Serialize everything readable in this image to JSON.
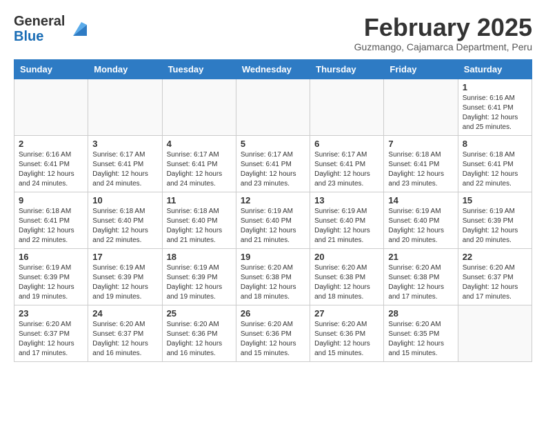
{
  "header": {
    "logo_general": "General",
    "logo_blue": "Blue",
    "month_title": "February 2025",
    "subtitle": "Guzmango, Cajamarca Department, Peru"
  },
  "days_of_week": [
    "Sunday",
    "Monday",
    "Tuesday",
    "Wednesday",
    "Thursday",
    "Friday",
    "Saturday"
  ],
  "weeks": [
    [
      {
        "day": "",
        "info": ""
      },
      {
        "day": "",
        "info": ""
      },
      {
        "day": "",
        "info": ""
      },
      {
        "day": "",
        "info": ""
      },
      {
        "day": "",
        "info": ""
      },
      {
        "day": "",
        "info": ""
      },
      {
        "day": "1",
        "info": "Sunrise: 6:16 AM\nSunset: 6:41 PM\nDaylight: 12 hours and 25 minutes."
      }
    ],
    [
      {
        "day": "2",
        "info": "Sunrise: 6:16 AM\nSunset: 6:41 PM\nDaylight: 12 hours and 24 minutes."
      },
      {
        "day": "3",
        "info": "Sunrise: 6:17 AM\nSunset: 6:41 PM\nDaylight: 12 hours and 24 minutes."
      },
      {
        "day": "4",
        "info": "Sunrise: 6:17 AM\nSunset: 6:41 PM\nDaylight: 12 hours and 24 minutes."
      },
      {
        "day": "5",
        "info": "Sunrise: 6:17 AM\nSunset: 6:41 PM\nDaylight: 12 hours and 23 minutes."
      },
      {
        "day": "6",
        "info": "Sunrise: 6:17 AM\nSunset: 6:41 PM\nDaylight: 12 hours and 23 minutes."
      },
      {
        "day": "7",
        "info": "Sunrise: 6:18 AM\nSunset: 6:41 PM\nDaylight: 12 hours and 23 minutes."
      },
      {
        "day": "8",
        "info": "Sunrise: 6:18 AM\nSunset: 6:41 PM\nDaylight: 12 hours and 22 minutes."
      }
    ],
    [
      {
        "day": "9",
        "info": "Sunrise: 6:18 AM\nSunset: 6:41 PM\nDaylight: 12 hours and 22 minutes."
      },
      {
        "day": "10",
        "info": "Sunrise: 6:18 AM\nSunset: 6:40 PM\nDaylight: 12 hours and 22 minutes."
      },
      {
        "day": "11",
        "info": "Sunrise: 6:18 AM\nSunset: 6:40 PM\nDaylight: 12 hours and 21 minutes."
      },
      {
        "day": "12",
        "info": "Sunrise: 6:19 AM\nSunset: 6:40 PM\nDaylight: 12 hours and 21 minutes."
      },
      {
        "day": "13",
        "info": "Sunrise: 6:19 AM\nSunset: 6:40 PM\nDaylight: 12 hours and 21 minutes."
      },
      {
        "day": "14",
        "info": "Sunrise: 6:19 AM\nSunset: 6:40 PM\nDaylight: 12 hours and 20 minutes."
      },
      {
        "day": "15",
        "info": "Sunrise: 6:19 AM\nSunset: 6:39 PM\nDaylight: 12 hours and 20 minutes."
      }
    ],
    [
      {
        "day": "16",
        "info": "Sunrise: 6:19 AM\nSunset: 6:39 PM\nDaylight: 12 hours and 19 minutes."
      },
      {
        "day": "17",
        "info": "Sunrise: 6:19 AM\nSunset: 6:39 PM\nDaylight: 12 hours and 19 minutes."
      },
      {
        "day": "18",
        "info": "Sunrise: 6:19 AM\nSunset: 6:39 PM\nDaylight: 12 hours and 19 minutes."
      },
      {
        "day": "19",
        "info": "Sunrise: 6:20 AM\nSunset: 6:38 PM\nDaylight: 12 hours and 18 minutes."
      },
      {
        "day": "20",
        "info": "Sunrise: 6:20 AM\nSunset: 6:38 PM\nDaylight: 12 hours and 18 minutes."
      },
      {
        "day": "21",
        "info": "Sunrise: 6:20 AM\nSunset: 6:38 PM\nDaylight: 12 hours and 17 minutes."
      },
      {
        "day": "22",
        "info": "Sunrise: 6:20 AM\nSunset: 6:37 PM\nDaylight: 12 hours and 17 minutes."
      }
    ],
    [
      {
        "day": "23",
        "info": "Sunrise: 6:20 AM\nSunset: 6:37 PM\nDaylight: 12 hours and 17 minutes."
      },
      {
        "day": "24",
        "info": "Sunrise: 6:20 AM\nSunset: 6:37 PM\nDaylight: 12 hours and 16 minutes."
      },
      {
        "day": "25",
        "info": "Sunrise: 6:20 AM\nSunset: 6:36 PM\nDaylight: 12 hours and 16 minutes."
      },
      {
        "day": "26",
        "info": "Sunrise: 6:20 AM\nSunset: 6:36 PM\nDaylight: 12 hours and 15 minutes."
      },
      {
        "day": "27",
        "info": "Sunrise: 6:20 AM\nSunset: 6:36 PM\nDaylight: 12 hours and 15 minutes."
      },
      {
        "day": "28",
        "info": "Sunrise: 6:20 AM\nSunset: 6:35 PM\nDaylight: 12 hours and 15 minutes."
      },
      {
        "day": "",
        "info": ""
      }
    ]
  ]
}
